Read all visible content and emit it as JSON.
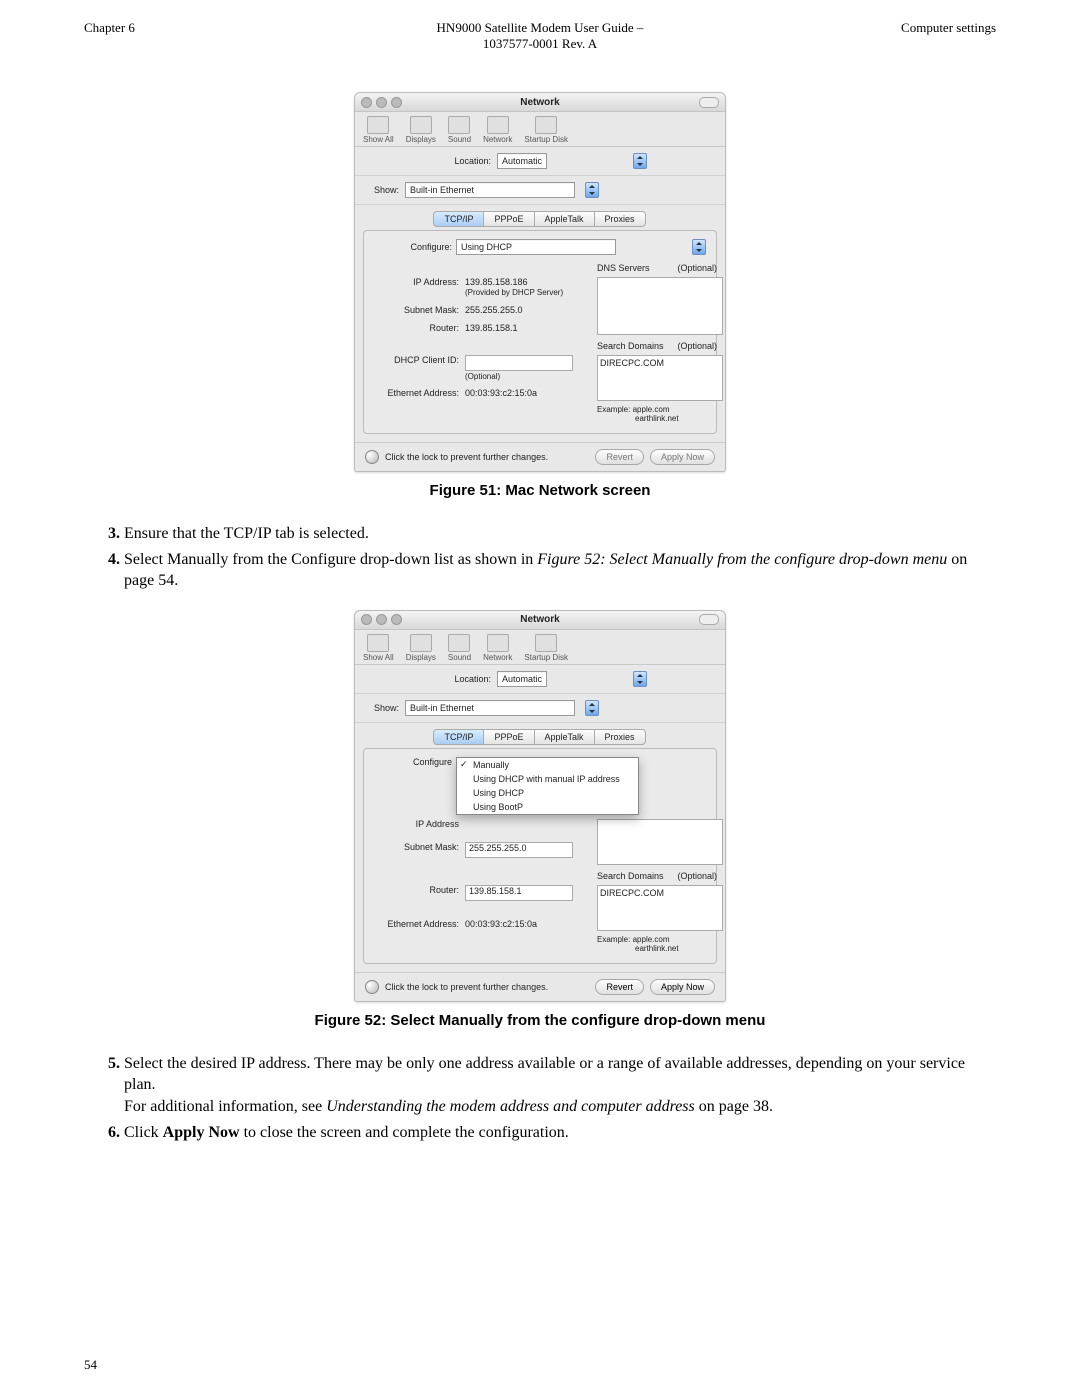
{
  "header": {
    "left": "Chapter 6",
    "center_line1": "HN9000 Satellite Modem User Guide –",
    "center_line2": "1037577-0001 Rev. A",
    "right": "Computer settings"
  },
  "fig51": {
    "caption": "Figure 51: Mac Network screen",
    "window": {
      "title": "Network",
      "toolbar": [
        "Show All",
        "Displays",
        "Sound",
        "Network",
        "Startup Disk"
      ],
      "location_label": "Location:",
      "location_value": "Automatic",
      "show_label": "Show:",
      "show_value": "Built-in Ethernet",
      "tabs": [
        "TCP/IP",
        "PPPoE",
        "AppleTalk",
        "Proxies"
      ],
      "active_tab": "TCP/IP",
      "configure_label": "Configure:",
      "configure_value": "Using DHCP",
      "ip_label": "IP Address:",
      "ip_value": "139.85.158.186",
      "ip_note": "(Provided by DHCP Server)",
      "subnet_label": "Subnet Mask:",
      "subnet_value": "255.255.255.0",
      "router_label": "Router:",
      "router_value": "139.85.158.1",
      "dhcp_client_label": "DHCP Client ID:",
      "dhcp_client_note": "(Optional)",
      "eth_label": "Ethernet Address:",
      "eth_value": "00:03:93:c2:15:0a",
      "dns_label": "DNS Servers",
      "dns_optional": "(Optional)",
      "search_label": "Search Domains",
      "search_value": "DIRECPC.COM",
      "search_optional": "(Optional)",
      "example_label": "Example:",
      "example_value1": "apple.com",
      "example_value2": "earthlink.net",
      "lock_text": "Click the lock to prevent further changes.",
      "revert": "Revert",
      "apply": "Apply Now"
    }
  },
  "steps_a": {
    "s3": "Ensure that the TCP/IP tab is selected.",
    "s4_a": "Select Manually from the Configure drop-down list as shown in ",
    "s4_ref": "Figure 52: Select Manually from the configure drop-down menu",
    "s4_b": " on page 54."
  },
  "fig52": {
    "caption": "Figure 52: Select Manually from the configure drop-down menu",
    "window": {
      "configure_label": "Configure",
      "dropdown_options": [
        "Manually",
        "Using DHCP with manual IP address",
        "Using DHCP",
        "Using BootP"
      ],
      "ip_label": "IP Address",
      "subnet_label": "Subnet Mask:",
      "subnet_value": "255.255.255.0",
      "router_label": "Router:",
      "router_value": "139.85.158.1",
      "eth_label": "Ethernet Address:",
      "eth_value": "00:03:93:c2:15:0a",
      "search_label": "Search Domains",
      "search_value": "DIRECPC.COM",
      "search_optional": "(Optional)",
      "example_label": "Example:",
      "example_value1": "apple.com",
      "example_value2": "earthlink.net",
      "lock_text": "Click the lock to prevent further changes.",
      "revert": "Revert",
      "apply": "Apply Now"
    }
  },
  "steps_b": {
    "s5_a": "Select the desired IP address. There may be only one address available or a range of available addresses, depending on your service plan.",
    "s5_b": "For additional information, see ",
    "s5_ref": "Understanding the modem address and computer address",
    "s5_c": " on page 38.",
    "s6_a": "Click ",
    "s6_bold": "Apply Now",
    "s6_b": " to close the screen and complete the configuration."
  },
  "page_number": "54"
}
